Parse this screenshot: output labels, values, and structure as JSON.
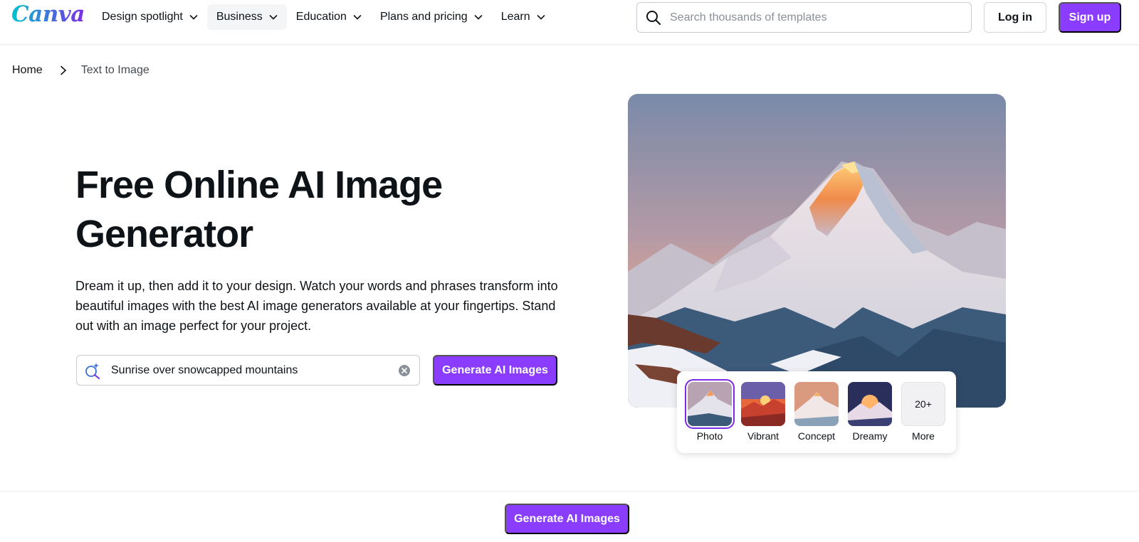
{
  "header": {
    "logo": "Canva",
    "nav": [
      {
        "label": "Design spotlight"
      },
      {
        "label": "Business"
      },
      {
        "label": "Education"
      },
      {
        "label": "Plans and pricing"
      },
      {
        "label": "Learn"
      }
    ],
    "search_placeholder": "Search thousands of templates",
    "login_label": "Log in",
    "signup_label": "Sign up"
  },
  "breadcrumb": {
    "home": "Home",
    "current": "Text to Image"
  },
  "hero": {
    "title": "Free Online AI Image Generator",
    "description": "Dream it up, then add it to your design. Watch your words and phrases transform into beautiful images with the best AI image generators available at your fingertips. Stand out with an image perfect for your project.",
    "prompt_value": "Sunrise over snowcapped mountains",
    "generate_label": "Generate AI Images"
  },
  "styles": {
    "options": [
      {
        "label": "Photo",
        "selected": true
      },
      {
        "label": "Vibrant",
        "selected": false
      },
      {
        "label": "Concept",
        "selected": false
      },
      {
        "label": "Dreamy",
        "selected": false
      },
      {
        "label": "More",
        "badge": "20+",
        "selected": false
      }
    ]
  },
  "bottom_bar": {
    "generate_label": "Generate AI Images"
  },
  "colors": {
    "brand_purple": "#8b3dff",
    "logo_purple": "#7d2ae8",
    "logo_teal": "#00c4cc"
  }
}
